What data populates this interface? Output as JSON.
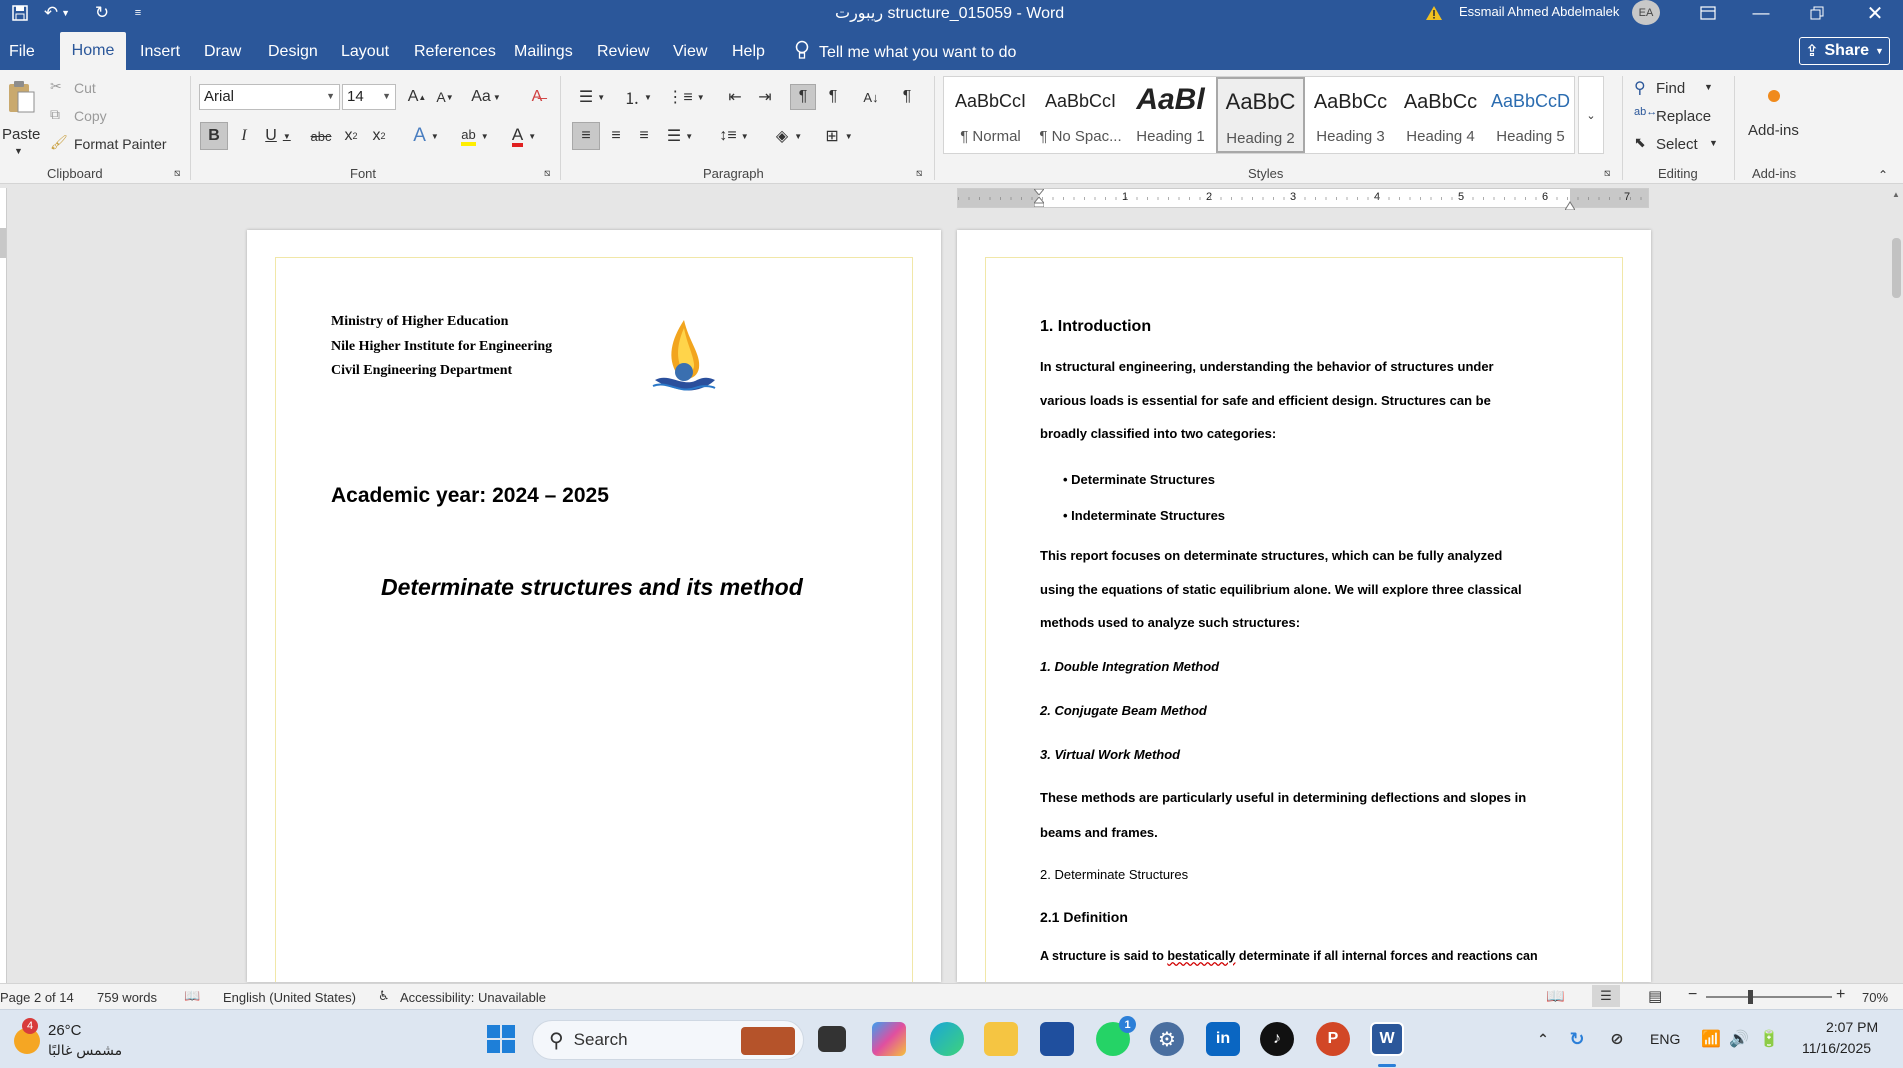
{
  "titlebar": {
    "doc_title": "ريبورت structure_015059  -  Word",
    "user_name": "Essmail Ahmed Abdelmalek",
    "user_initials": "EA"
  },
  "menu": {
    "tabs": [
      "File",
      "Home",
      "Insert",
      "Draw",
      "Design",
      "Layout",
      "References",
      "Mailings",
      "Review",
      "View",
      "Help"
    ],
    "tell_me": "Tell me what you want to do",
    "share": "Share"
  },
  "ribbon": {
    "clipboard": {
      "paste": "Paste",
      "cut": "Cut",
      "copy": "Copy",
      "format_painter": "Format Painter",
      "label": "Clipboard"
    },
    "font": {
      "font_name": "Arial",
      "font_size": "14",
      "label": "Font"
    },
    "paragraph": {
      "label": "Paragraph"
    },
    "styles": {
      "label": "Styles",
      "items": [
        {
          "sample": "AaBbCcI",
          "name": "¶ Normal"
        },
        {
          "sample": "AaBbCcI",
          "name": "¶ No Spac..."
        },
        {
          "sample": "AaBl",
          "name": "Heading 1"
        },
        {
          "sample": "AaBbC",
          "name": "Heading 2"
        },
        {
          "sample": "AaBbCc",
          "name": "Heading 3"
        },
        {
          "sample": "AaBbCc",
          "name": "Heading 4"
        },
        {
          "sample": "AaBbCcD",
          "name": "Heading 5"
        }
      ]
    },
    "editing": {
      "find": "Find",
      "replace": "Replace",
      "select": "Select",
      "label": "Editing"
    },
    "addins": {
      "button": "Add-ins",
      "label": "Add-ins"
    }
  },
  "ruler": {
    "numbers": [
      "1",
      "2",
      "3",
      "4",
      "5",
      "6",
      "7"
    ]
  },
  "page1": {
    "header_lines": [
      "Ministry of Higher Education",
      "Nile Higher Institute for Engineering",
      "Civil Engineering Department"
    ],
    "academic_year": "Academic year: 2024 – 2025",
    "title": "Determinate structures and its method"
  },
  "page2": {
    "heading": "1. Introduction",
    "intro_lines": [
      "In structural engineering, understanding the behavior of structures under",
      "various loads is essential for safe and efficient design. Structures can be",
      "broadly classified into two categories:"
    ],
    "bullets": [
      "• Determinate Structures",
      "• Indeterminate Structures"
    ],
    "focus_lines": [
      "This report focuses on determinate structures, which can be fully analyzed",
      "using the equations of static equilibrium alone. We will explore three classical",
      "methods used to analyze such structures:"
    ],
    "methods": [
      "1. Double Integration Method",
      "2. Conjugate Beam Method",
      "3. Virtual Work Method"
    ],
    "useful_lines": [
      "These methods are particularly useful in determining deflections and slopes in",
      "beams and frames."
    ],
    "section2": "2. Determinate Structures",
    "section21": "2.1 Definition",
    "def_line_pre": "A structure is said to ",
    "def_line_misspelled": "bestatically",
    "def_line_post": " determinate if all internal forces and reactions can"
  },
  "statusbar": {
    "page": "Page 2 of 14",
    "words": "759 words",
    "language": "English (United States)",
    "accessibility": "Accessibility: Unavailable",
    "zoom": "70%"
  },
  "taskbar": {
    "weather_temp": "26°C",
    "weather_desc": "مشمس غالبًا",
    "weather_badge": "4",
    "search": "Search",
    "whatsapp_badge": "1",
    "language": "ENG",
    "time": "2:07 PM",
    "date": "11/16/2025"
  },
  "colors": {
    "word_blue": "#2b579a",
    "margin_guide": "#f1e7a8"
  }
}
